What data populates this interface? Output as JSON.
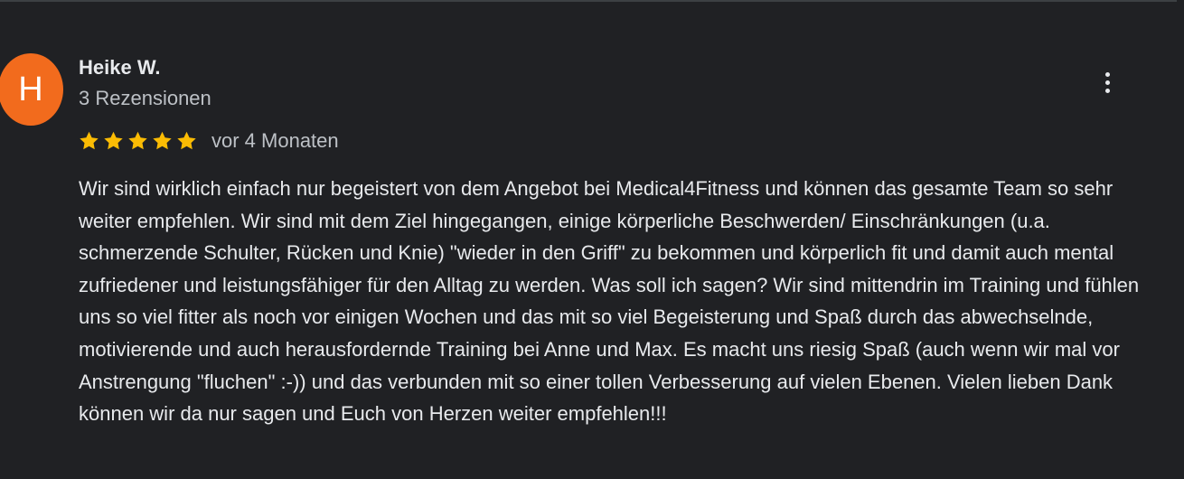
{
  "review": {
    "author": {
      "initial": "H",
      "name": "Heike W.",
      "review_count": "3 Rezensionen",
      "avatar_color": "#f26b1d"
    },
    "rating": {
      "stars": 5,
      "max_stars": 5,
      "star_color": "#fbbc04"
    },
    "time_ago": "vor 4 Monaten",
    "text": "Wir sind wirklich einfach nur begeistert von dem Angebot bei Medical4Fitness und können das gesamte Team so sehr weiter empfehlen. Wir sind mit dem Ziel hingegangen, einige körperliche Beschwerden/ Einschränkungen (u.a. schmerzende Schulter, Rücken und Knie) \"wieder in den Griff\" zu bekommen und körperlich fit und damit auch mental zufriedener und leistungsfähiger für den Alltag zu werden. Was soll ich sagen? Wir sind mittendrin im Training und fühlen uns so viel fitter als noch vor einigen Wochen und das mit so viel Begeisterung und Spaß durch das abwechselnde, motivierende und auch herausfordernde Training bei Anne und Max. Es macht uns riesig Spaß (auch wenn wir mal vor Anstrengung \"fluchen\" :-))  und das verbunden mit so einer tollen Verbesserung auf vielen Ebenen. Vielen lieben Dank können wir da nur sagen und Euch von Herzen weiter empfehlen!!!",
    "more_icon": "more-vert-icon"
  },
  "theme": {
    "background": "#202124",
    "divider": "#3c4043",
    "text_primary": "#e8eaed",
    "text_secondary": "#bdc1c6"
  }
}
